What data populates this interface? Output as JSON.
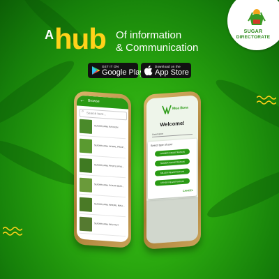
{
  "brand": {
    "logo_line1": "SUGAR",
    "logo_line2": "DIRECTORATE"
  },
  "headline": {
    "prefix": "A",
    "highlight": "hub",
    "line1": "Of information",
    "line2": "& Communication"
  },
  "stores": {
    "google_small": "GET IT ON",
    "google_large": "Google Play",
    "apple_small": "Download on the",
    "apple_large": "App Store"
  },
  "left_phone": {
    "header_title": "Browse",
    "search_placeholder": "Search here...",
    "items": [
      "SUGARCANE RATOON",
      "SUGARCANE NODAL PROPAGATION",
      "SUGARCANE PHOTO PROPAGATION",
      "SUGARCANE POKAH BOENG DISEASE",
      "SUGARCANE WHORL MAGGOT BORER",
      "SUGARCANE RED ROT"
    ]
  },
  "right_phone": {
    "logo_text": "Mua Bora",
    "welcome": "Welcome!",
    "field_label": "Username",
    "dialog_title": "Select type of user",
    "options": [
      "FARMER REGISTRATION",
      "TRADER REGISTRATION",
      "MILLER REGISTRATION",
      "OTHER REGISTRATION"
    ],
    "cancel": "CANCEL"
  },
  "colors": {
    "accent_yellow": "#ffd21a",
    "brand_green": "#2c8a1a",
    "bg_green": "#2aa80f"
  },
  "icons": {
    "google_play": "google-play-icon",
    "apple": "apple-icon",
    "back": "back-arrow-icon",
    "search": "search-icon"
  }
}
